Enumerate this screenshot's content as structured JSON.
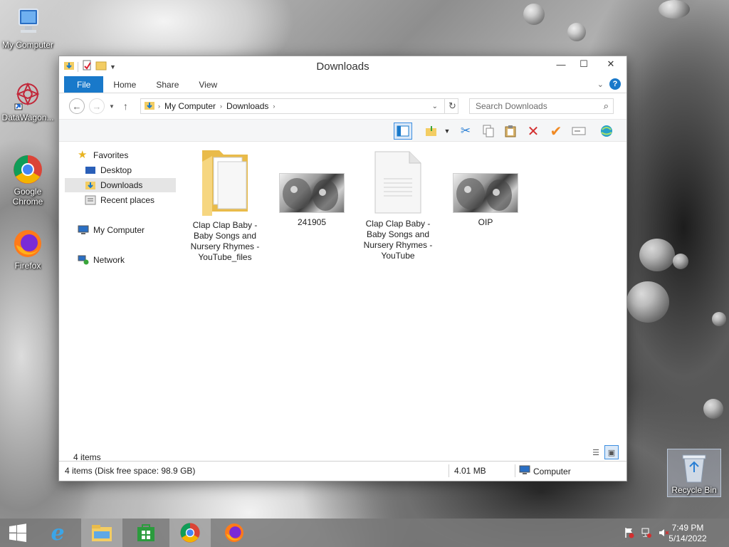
{
  "desktop": {
    "icons": [
      {
        "label": "My Computer"
      },
      {
        "label": "DataWagon..."
      },
      {
        "label": "Google Chrome"
      },
      {
        "label": "Firefox"
      }
    ],
    "recycle_bin": {
      "label": "Recycle Bin"
    }
  },
  "window": {
    "title": "Downloads",
    "ribbon_tabs": [
      "File",
      "Home",
      "Share",
      "View"
    ],
    "address": {
      "crumbs": [
        "My Computer",
        "Downloads"
      ]
    },
    "search": {
      "placeholder": "Search Downloads"
    },
    "nav_pane": {
      "favorites": "Favorites",
      "desktop": "Desktop",
      "downloads": "Downloads",
      "recent": "Recent places",
      "my_computer": "My Computer",
      "network": "Network"
    },
    "files": [
      {
        "name": "Clap Clap Baby - Baby Songs and Nursery Rhymes - YouTube_files",
        "kind": "folder"
      },
      {
        "name": "241905",
        "kind": "image"
      },
      {
        "name": "Clap Clap Baby - Baby Songs and Nursery Rhymes - YouTube",
        "kind": "document"
      },
      {
        "name": "OIP",
        "kind": "image"
      }
    ],
    "item_count": "4 items",
    "status": {
      "summary": "4 items (Disk free space: 98.9 GB)",
      "size": "4.01 MB",
      "location": "Computer"
    }
  },
  "taskbar": {
    "time": "7:49 PM",
    "date": "5/14/2022"
  },
  "colors": {
    "accent": "#1979ca",
    "selected_nav": "#e5e5e5",
    "folder_yellow": "#f3cd63"
  }
}
